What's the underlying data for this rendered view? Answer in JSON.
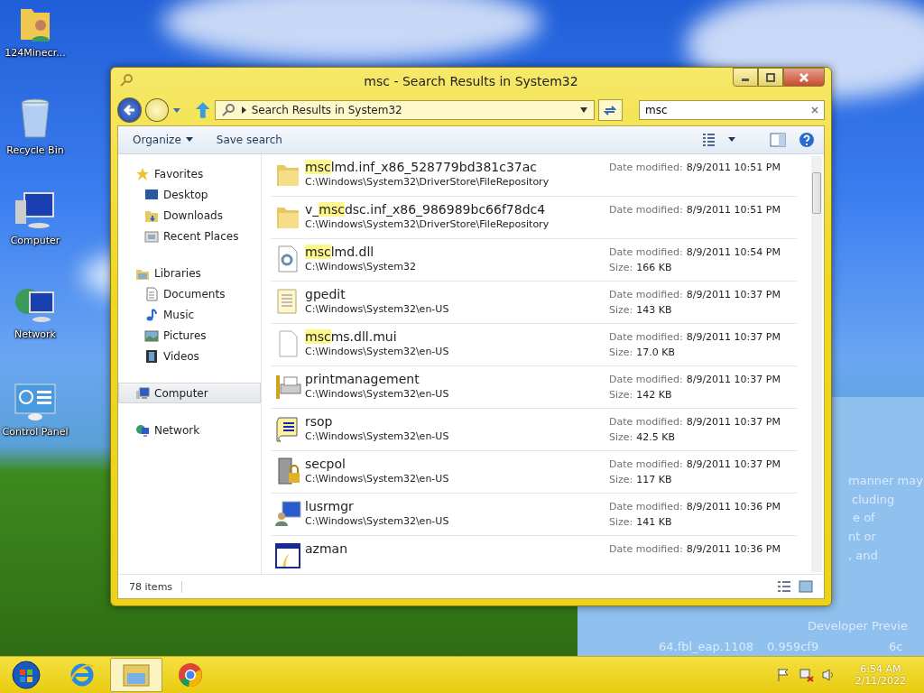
{
  "desktop": {
    "icons": [
      {
        "kind": "user-folder",
        "label": "124Minecr..."
      },
      {
        "kind": "recycle",
        "label": "Recycle Bin"
      },
      {
        "kind": "computer",
        "label": "Computer"
      },
      {
        "kind": "network",
        "label": "Network"
      },
      {
        "kind": "control",
        "label": "Control Panel"
      }
    ],
    "wallpaper_text": [
      "manner may",
      "cluding",
      "e of",
      "nt or",
      ", and",
      "Developer Previe",
      "64.fbl_eap.1108",
      "0.959cf9",
      "6c"
    ]
  },
  "window": {
    "title": "msc - Search Results in System32",
    "address": {
      "crumb": "Search Results in System32"
    },
    "search": {
      "value": "msc"
    },
    "toolbar": [
      "Organize",
      "Save search"
    ],
    "nav": [
      {
        "label": "Favorites",
        "kind": "star",
        "selected": false,
        "children": [
          {
            "label": "Desktop",
            "kind": "desktop",
            "selected": false
          },
          {
            "label": "Downloads",
            "kind": "downloads",
            "selected": false
          },
          {
            "label": "Recent Places",
            "kind": "recent",
            "selected": false
          }
        ]
      },
      {
        "label": "Libraries",
        "kind": "libraries",
        "selected": false,
        "children": [
          {
            "label": "Documents",
            "kind": "documents",
            "selected": false
          },
          {
            "label": "Music",
            "kind": "music",
            "selected": false
          },
          {
            "label": "Pictures",
            "kind": "pictures",
            "selected": false
          },
          {
            "label": "Videos",
            "kind": "videos",
            "selected": false
          }
        ]
      },
      {
        "label": "Computer",
        "kind": "computer",
        "selected": true
      },
      {
        "label": "Network",
        "kind": "network",
        "selected": false
      }
    ],
    "results": [
      {
        "kind": "folder",
        "name_parts": [
          {
            "text": "msc",
            "highlighted": true
          },
          {
            "text": "lmd.inf_x86_528779bd381c37ac",
            "highlighted": false
          }
        ],
        "path": "C:\\Windows\\System32\\DriverStore\\FileRepository",
        "meta": [
          {
            "label": "Date modified:",
            "value": "8/9/2011 10:51 PM"
          }
        ]
      },
      {
        "kind": "folder",
        "name_parts": [
          {
            "text": "v_",
            "highlighted": false
          },
          {
            "text": "msc",
            "highlighted": true
          },
          {
            "text": "dsc.inf_x86_986989bc66f78dc4",
            "highlighted": false
          }
        ],
        "path": "C:\\Windows\\System32\\DriverStore\\FileRepository",
        "meta": [
          {
            "label": "Date modified:",
            "value": "8/9/2011 10:51 PM"
          }
        ]
      },
      {
        "kind": "dll",
        "name_parts": [
          {
            "text": "msc",
            "highlighted": true
          },
          {
            "text": "lmd.dll",
            "highlighted": false
          }
        ],
        "path": "C:\\Windows\\System32",
        "meta": [
          {
            "label": "Date modified:",
            "value": "8/9/2011 10:54 PM"
          },
          {
            "label": "Size:",
            "value": "166 KB"
          }
        ]
      },
      {
        "kind": "text",
        "name_parts": [
          {
            "text": "gpedit",
            "highlighted": false
          }
        ],
        "path": "C:\\Windows\\System32\\en-US",
        "meta": [
          {
            "label": "Date modified:",
            "value": "8/9/2011 10:37 PM"
          },
          {
            "label": "Size:",
            "value": "143 KB"
          }
        ]
      },
      {
        "kind": "blank",
        "name_parts": [
          {
            "text": "msc",
            "highlighted": true
          },
          {
            "text": "ms.dll.mui",
            "highlighted": false
          }
        ],
        "path": "C:\\Windows\\System32\\en-US",
        "meta": [
          {
            "label": "Date modified:",
            "value": "8/9/2011 10:37 PM"
          },
          {
            "label": "Size:",
            "value": "17.0 KB"
          }
        ]
      },
      {
        "kind": "printer",
        "name_parts": [
          {
            "text": "printmanagement",
            "highlighted": false
          }
        ],
        "path": "C:\\Windows\\System32\\en-US",
        "meta": [
          {
            "label": "Date modified:",
            "value": "8/9/2011 10:37 PM"
          },
          {
            "label": "Size:",
            "value": "142 KB"
          }
        ]
      },
      {
        "kind": "script",
        "name_parts": [
          {
            "text": "rsop",
            "highlighted": false
          }
        ],
        "path": "C:\\Windows\\System32\\en-US",
        "meta": [
          {
            "label": "Date modified:",
            "value": "8/9/2011 10:37 PM"
          },
          {
            "label": "Size:",
            "value": "42.5 KB"
          }
        ]
      },
      {
        "kind": "server",
        "name_parts": [
          {
            "text": "secpol",
            "highlighted": false
          }
        ],
        "path": "C:\\Windows\\System32\\en-US",
        "meta": [
          {
            "label": "Date modified:",
            "value": "8/9/2011 10:37 PM"
          },
          {
            "label": "Size:",
            "value": "117 KB"
          }
        ]
      },
      {
        "kind": "users",
        "name_parts": [
          {
            "text": "lusrmgr",
            "highlighted": false
          }
        ],
        "path": "C:\\Windows\\System32\\en-US",
        "meta": [
          {
            "label": "Date modified:",
            "value": "8/9/2011 10:36 PM"
          },
          {
            "label": "Size:",
            "value": "141 KB"
          }
        ]
      },
      {
        "kind": "app",
        "name_parts": [
          {
            "text": "azman",
            "highlighted": false
          }
        ],
        "meta": [
          {
            "label": "Date modified:",
            "value": "8/9/2011 10:36 PM"
          }
        ]
      }
    ],
    "status": "78 items"
  },
  "taskbar": {
    "apps": [
      {
        "kind": "start",
        "selected": false
      },
      {
        "kind": "ie",
        "selected": false
      },
      {
        "kind": "explorer",
        "selected": true
      },
      {
        "kind": "chrome",
        "selected": false
      }
    ],
    "time": "6:54 AM",
    "date": "2/11/2022"
  }
}
